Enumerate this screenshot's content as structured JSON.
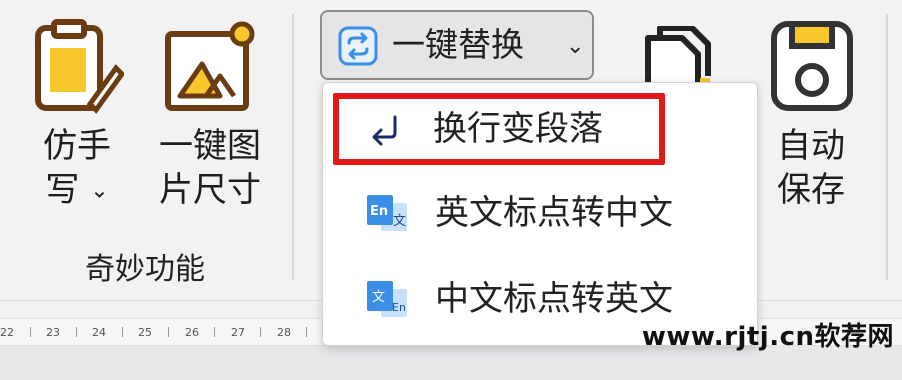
{
  "tools": {
    "imitate_handwriting": {
      "line1": "仿手",
      "line2": "写"
    },
    "image_size": {
      "line1": "一键图",
      "line2": "片尺寸"
    },
    "group_label": "奇妙功能",
    "auto_save": {
      "line1": "自动",
      "line2": "保存"
    }
  },
  "replace_button": {
    "label": "一键替换",
    "icon": "swap-arrows-icon"
  },
  "dropdown": {
    "items": [
      {
        "label": "换行变段落",
        "icon": "return-arrow-icon",
        "highlighted": true
      },
      {
        "label": "英文标点转中文",
        "icon": "en-to-zh-icon",
        "highlighted": false
      },
      {
        "label": "中文标点转英文",
        "icon": "zh-to-en-icon",
        "highlighted": false
      }
    ],
    "en_icon_text": "En",
    "zh_icon_text": "文"
  },
  "ruler": {
    "ticks": [
      "22",
      "23",
      "24",
      "25",
      "26",
      "27",
      "28"
    ]
  },
  "watermark": "www.rjtj.cn软荐网",
  "colors": {
    "icon_outline": "#6b3c12",
    "icon_fill": "#f7c72b",
    "accent_blue": "#3a8ee6",
    "highlight_red": "#e01919"
  }
}
